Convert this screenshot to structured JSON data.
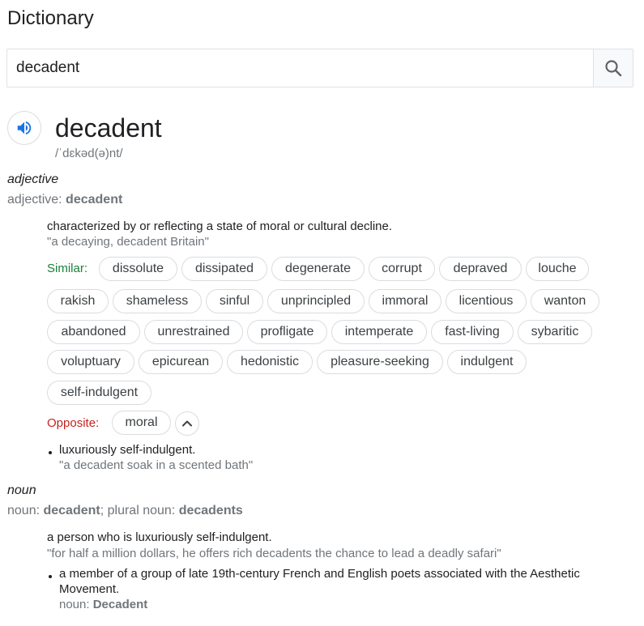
{
  "header": {
    "title": "Dictionary"
  },
  "search": {
    "value": "decadent"
  },
  "entry": {
    "word": "decadent",
    "phonetic": "/ˈdɛkəd(ə)nt/"
  },
  "adjective": {
    "pos": "adjective",
    "forms_label": "adjective: ",
    "forms_word": "decadent",
    "definition": "characterized by or reflecting a state of moral or cultural decline.",
    "example": "\"a decaying, decadent Britain\"",
    "similar_label": "Similar:",
    "similar": [
      "dissolute",
      "dissipated",
      "degenerate",
      "corrupt",
      "depraved",
      "louche",
      "rakish",
      "shameless",
      "sinful",
      "unprincipled",
      "immoral",
      "licentious",
      "wanton",
      "abandoned",
      "unrestrained",
      "profligate",
      "intemperate",
      "fast-living",
      "sybaritic",
      "voluptuary",
      "epicurean",
      "hedonistic",
      "pleasure-seeking",
      "indulgent",
      "self-indulgent"
    ],
    "opposite_label": "Opposite:",
    "opposite": [
      "moral"
    ],
    "sub_definition": "luxuriously self-indulgent.",
    "sub_example": "\"a decadent soak in a scented bath\""
  },
  "noun": {
    "pos": "noun",
    "forms_label1": "noun: ",
    "forms_word1": "decadent",
    "forms_sep": "; plural noun: ",
    "forms_word2": "decadents",
    "definition": "a person who is luxuriously self-indulgent.",
    "example": "\"for half a million dollars, he offers rich decadents the chance to lead a deadly safari\"",
    "sub_definition_line1": "a member of a group of late 19th-century French and English poets associated with the Aesthetic",
    "sub_definition_line2": "Movement.",
    "sub_forms_label": "noun: ",
    "sub_forms_word": "Decadent"
  },
  "colors": {
    "similar": "#188038",
    "opposite": "#c5221f",
    "speaker": "#1a73e8"
  },
  "icons": {
    "search": "search-icon",
    "speaker": "speaker-icon",
    "collapse": "chevron-up-icon"
  }
}
